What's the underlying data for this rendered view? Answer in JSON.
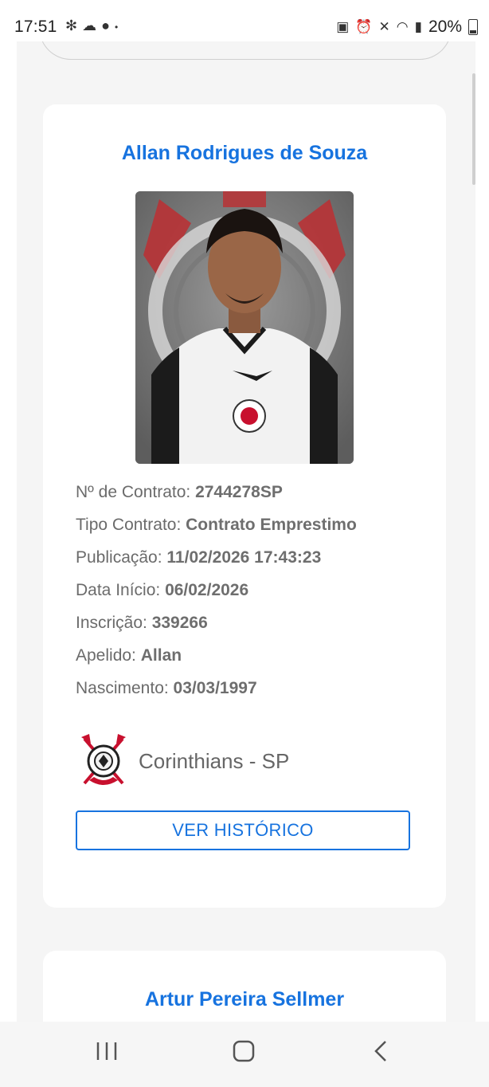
{
  "status_bar": {
    "time": "17:51",
    "battery": "20%",
    "left_icons": [
      "fan-icon",
      "cloud-icon",
      "chat-icon",
      "dot-icon"
    ],
    "right_icons": [
      "lock-icon",
      "alarm-icon",
      "mute-icon",
      "wifi-icon",
      "signal-icon",
      "battery-icon"
    ]
  },
  "players": [
    {
      "name": "Allan Rodrigues de Souza",
      "fields": [
        {
          "label": "Nº de Contrato: ",
          "value": "2744278SP"
        },
        {
          "label": "Tipo Contrato: ",
          "value": "Contrato Emprestimo"
        },
        {
          "label": "Publicação: ",
          "value": "11/02/2026 17:43:23"
        },
        {
          "label": "Data Início: ",
          "value": "06/02/2026"
        },
        {
          "label": "Inscrição: ",
          "value": "339266"
        },
        {
          "label": "Apelido: ",
          "value": "Allan"
        },
        {
          "label": "Nascimento: ",
          "value": "03/03/1997"
        }
      ],
      "club": "Corinthians - SP",
      "history_button": "VER HISTÓRICO"
    },
    {
      "name": "Artur Pereira Sellmer"
    }
  ],
  "navbar": {
    "recent": "recent-apps-icon",
    "home": "home-icon",
    "back": "back-icon"
  },
  "colors": {
    "accent": "#1773df",
    "page_bg": "#f5f5f5",
    "card_bg": "#ffffff",
    "club_red": "#c8102e"
  }
}
